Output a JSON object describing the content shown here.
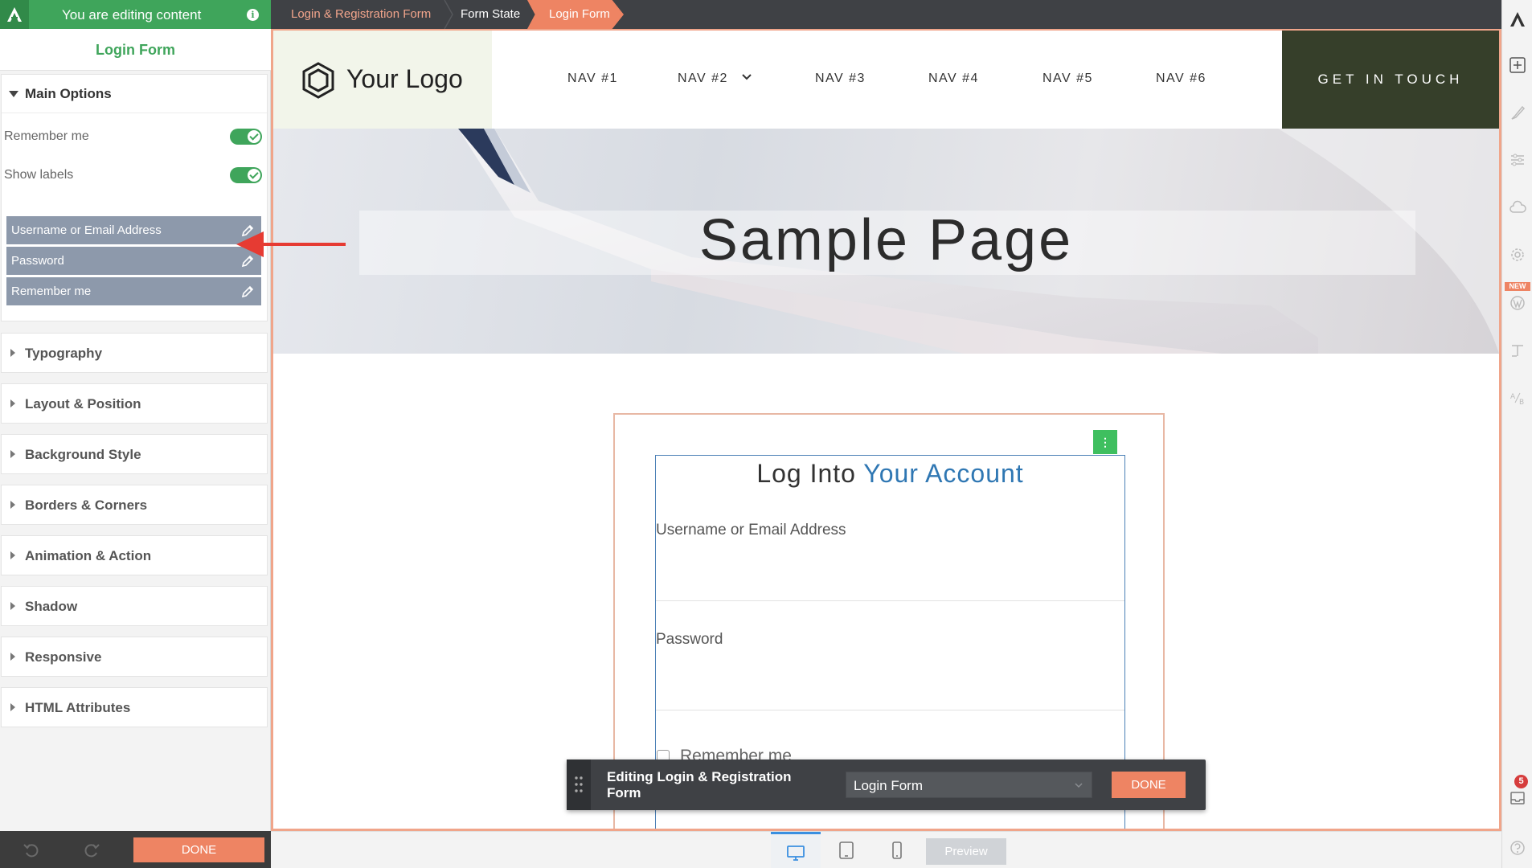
{
  "editor": {
    "editing_label": "You are editing content",
    "panel_title": "Login Form",
    "main_options": {
      "header": "Main Options",
      "toggles": [
        {
          "label": "Remember me",
          "on": true
        },
        {
          "label": "Show labels",
          "on": true
        }
      ],
      "fields": [
        {
          "label": "Username or Email Address"
        },
        {
          "label": "Password"
        },
        {
          "label": "Remember me"
        }
      ]
    },
    "sections": [
      "Typography",
      "Layout & Position",
      "Background Style",
      "Borders & Corners",
      "Animation & Action",
      "Shadow",
      "Responsive",
      "HTML Attributes"
    ],
    "done_label": "DONE"
  },
  "breadcrumbs": [
    "Login & Registration Form",
    "Form State",
    "Login Form"
  ],
  "site": {
    "logo_text": "Your Logo",
    "nav": [
      "NAV #1",
      "NAV #2",
      "NAV #3",
      "NAV #4",
      "NAV #5",
      "NAV #6"
    ],
    "cta": "GET IN TOUCH",
    "hero_title": "Sample Page"
  },
  "login": {
    "title_part1": "Log Into",
    "title_part2": "Your Account",
    "username_label": "Username or Email Address",
    "password_label": "Password",
    "remember_label": "Remember me",
    "menu_glyph": "⋮"
  },
  "floating_bar": {
    "title": "Editing Login & Registration Form",
    "selected_form": "Login Form",
    "done_label": "DONE"
  },
  "bottom_bar": {
    "preview_label": "Preview"
  },
  "right_toolbar": {
    "new_badge": "NEW",
    "notification_count": "5"
  },
  "colors": {
    "editor_green": "#3fa55b",
    "accent_orange": "#ee8463",
    "cta_dark_green": "#363f2a",
    "login_blue": "#2f77b3",
    "toolbar_dark": "#3f4145"
  },
  "icons": [
    "app-logo-icon",
    "info-icon",
    "pencil-icon",
    "undo-icon",
    "redo-icon",
    "plus-icon",
    "brush-icon",
    "sliders-icon",
    "cloud-icon",
    "gear-icon",
    "wordpress-icon",
    "text-icon",
    "ab-test-icon",
    "inbox-icon",
    "help-icon",
    "hexagon-logo-icon",
    "chevron-down-icon",
    "drag-handle-icon",
    "desktop-icon",
    "tablet-icon",
    "phone-icon"
  ]
}
